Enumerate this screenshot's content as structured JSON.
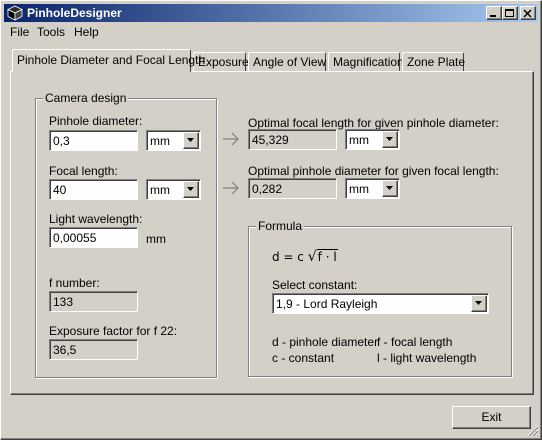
{
  "window": {
    "title": "PinholeDesigner"
  },
  "menu": [
    "File",
    "Tools",
    "Help"
  ],
  "tabs": [
    "Pinhole Diameter and Focal Length",
    "Exposure",
    "Angle of View",
    "Magnification",
    "Zone Plate"
  ],
  "active_tab": 0,
  "camera_design": {
    "legend": "Camera design",
    "pinhole_diameter": {
      "label": "Pinhole diameter:",
      "value": "0,3",
      "unit": "mm"
    },
    "focal_length": {
      "label": "Focal length:",
      "value": "40",
      "unit": "mm"
    },
    "light_wavelength": {
      "label": "Light wavelength:",
      "value": "0,00055",
      "unit": "mm"
    },
    "f_number": {
      "label": "f number:",
      "value": "133"
    },
    "exposure_factor": {
      "label": "Exposure factor for f 22:",
      "value": "36,5"
    }
  },
  "optimal_focal": {
    "label": "Optimal focal length for given pinhole diameter:",
    "value": "45,329",
    "unit": "mm"
  },
  "optimal_pinhole": {
    "label": "Optimal pinhole diameter for given focal length:",
    "value": "0,282",
    "unit": "mm"
  },
  "formula": {
    "legend": "Formula",
    "lhs": "d = c",
    "radicand": "f · l",
    "select_label": "Select constant:",
    "constant": "1,9 - Lord Rayleigh",
    "legend_items": {
      "d": "d - pinhole diameter",
      "f": "f - focal length",
      "c": "c - constant",
      "l": "l - light wavelength"
    }
  },
  "buttons": {
    "exit": "Exit"
  }
}
